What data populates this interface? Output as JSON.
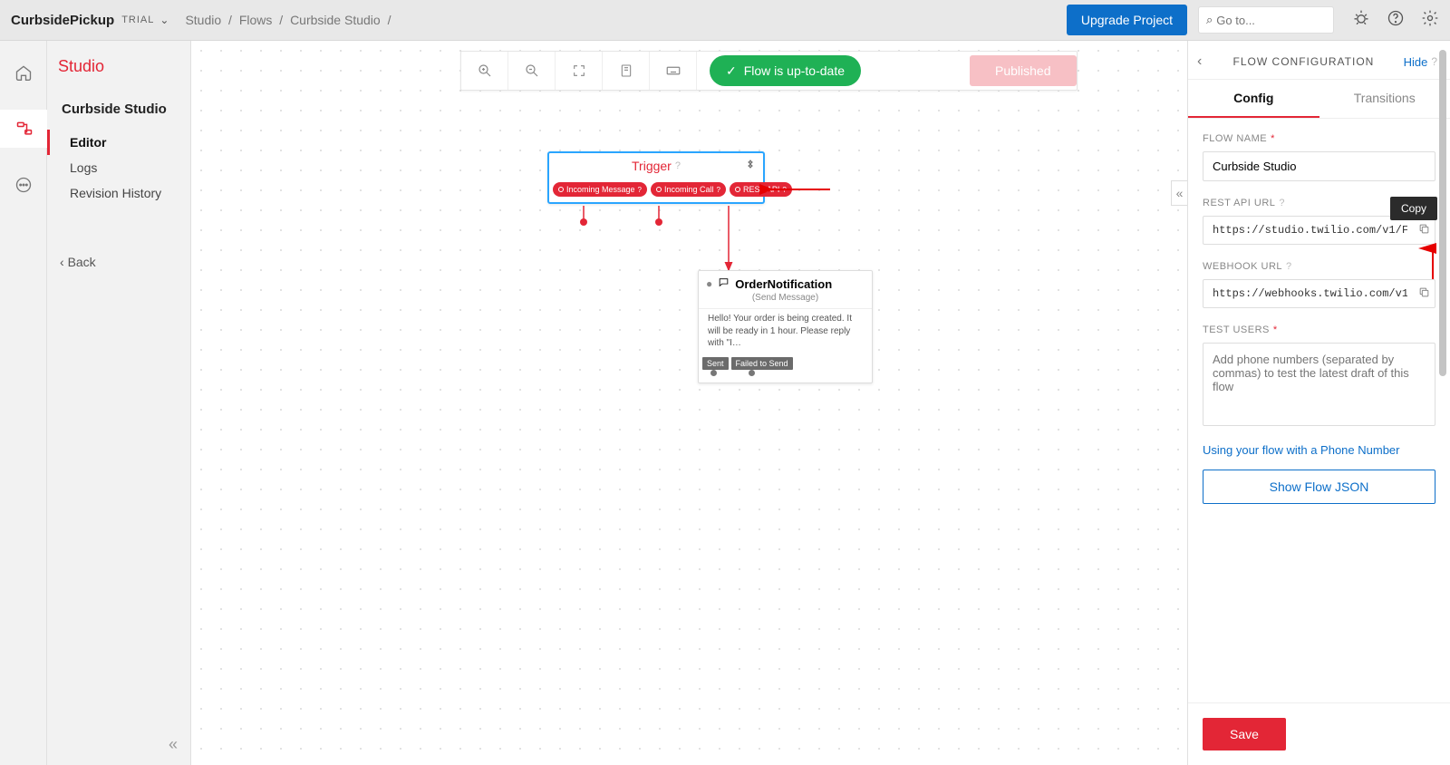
{
  "header": {
    "project_name": "CurbsidePickup",
    "trial_label": "TRIAL",
    "breadcrumb": [
      "Studio",
      "Flows",
      "Curbside Studio",
      ""
    ],
    "upgrade_label": "Upgrade Project",
    "search_placeholder": "Go to..."
  },
  "sidebar": {
    "title": "Studio",
    "section": "Curbside Studio",
    "items": [
      "Editor",
      "Logs",
      "Revision History"
    ],
    "active_index": 0,
    "back_label": "Back"
  },
  "toolbar": {
    "status_label": "Flow is up-to-date",
    "publish_label": "Published"
  },
  "nodes": {
    "trigger": {
      "title": "Trigger",
      "events": [
        "Incoming Message",
        "Incoming Call",
        "REST API"
      ]
    },
    "order": {
      "title": "OrderNotification",
      "subtitle": "(Send Message)",
      "body": "Hello! Your order is being created. It will be ready in 1 hour. Please reply with \"I…",
      "tags": [
        "Sent",
        "Failed to Send"
      ]
    }
  },
  "panel": {
    "header_title": "FLOW CONFIGURATION",
    "hide_label": "Hide",
    "tabs": [
      "Config",
      "Transitions"
    ],
    "active_tab": 0,
    "flow_name_label": "FLOW NAME",
    "flow_name_value": "Curbside Studio",
    "rest_label": "REST API URL",
    "rest_value": "https://studio.twilio.com/v1/F",
    "copy_tooltip": "Copy",
    "webhook_label": "WEBHOOK URL",
    "webhook_value": "https://webhooks.twilio.com/v1/",
    "test_users_label": "TEST USERS",
    "test_users_placeholder": "Add phone numbers (separated by commas) to test the latest draft of this flow",
    "phone_link": "Using your flow with a Phone Number",
    "show_json_label": "Show Flow JSON",
    "save_label": "Save"
  }
}
